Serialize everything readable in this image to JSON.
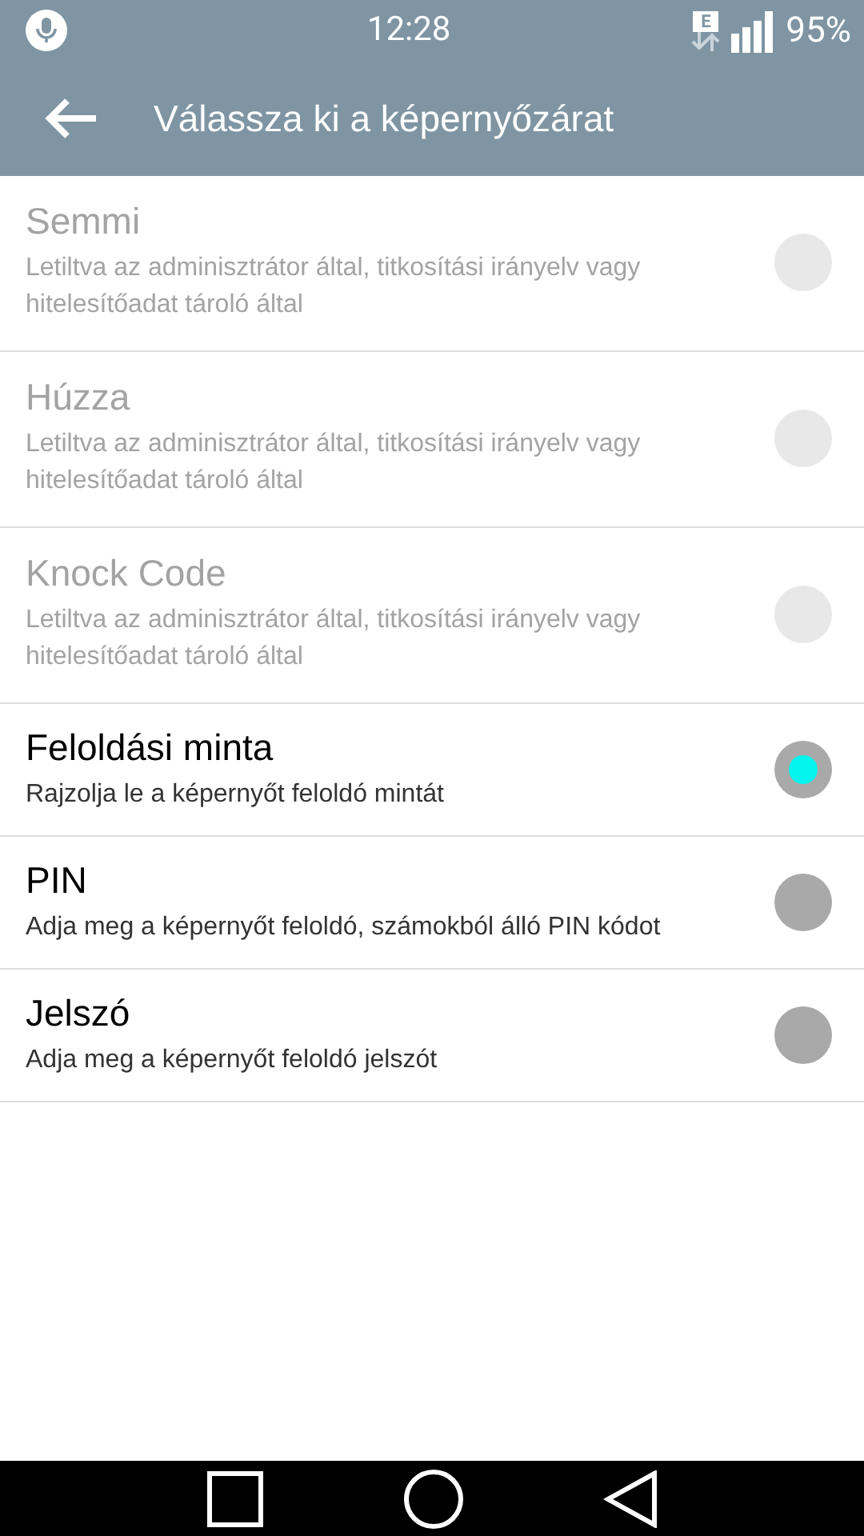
{
  "status_bar": {
    "time": "12:28",
    "network_label": "E",
    "battery": "95%"
  },
  "header": {
    "title": "Válassza ki a képernyőzárat"
  },
  "options": [
    {
      "title": "Semmi",
      "subtitle": "Letiltva az adminisztrátor által, titkosítási irányelv vagy hitelesítőadat tároló által",
      "disabled": true,
      "selected": false
    },
    {
      "title": "Húzza",
      "subtitle": "Letiltva az adminisztrátor által, titkosítási irányelv vagy hitelesítőadat tároló által",
      "disabled": true,
      "selected": false
    },
    {
      "title": "Knock Code",
      "subtitle": "Letiltva az adminisztrátor által, titkosítási irányelv vagy hitelesítőadat tároló által",
      "disabled": true,
      "selected": false
    },
    {
      "title": "Feloldási minta",
      "subtitle": "Rajzolja le a képernyőt feloldó mintát",
      "disabled": false,
      "selected": true
    },
    {
      "title": "PIN",
      "subtitle": "Adja meg a képernyőt feloldó, számokból álló PIN kódot",
      "disabled": false,
      "selected": false
    },
    {
      "title": "Jelszó",
      "subtitle": "Adja meg a képernyőt feloldó jelszót",
      "disabled": false,
      "selected": false
    }
  ]
}
